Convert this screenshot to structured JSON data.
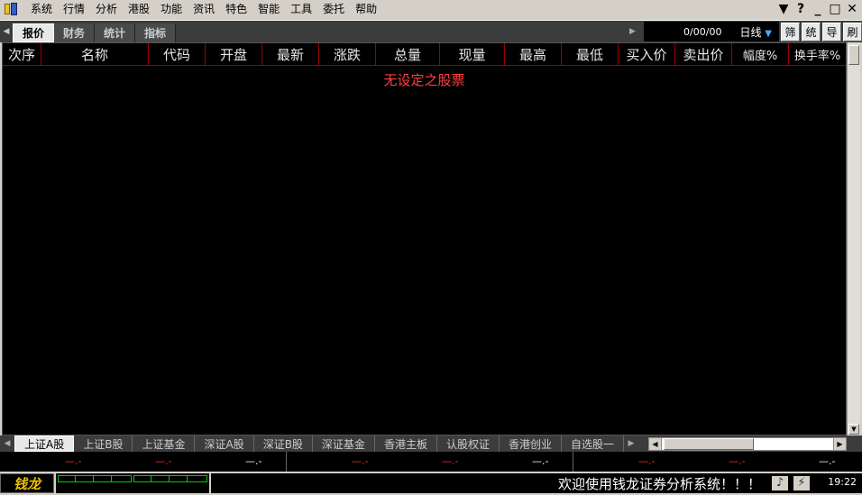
{
  "menu": [
    "系统",
    "行情",
    "分析",
    "港股",
    "功能",
    "资讯",
    "特色",
    "智能",
    "工具",
    "委托",
    "帮助"
  ],
  "window_controls": [
    "▼",
    "?",
    "_",
    "□",
    "✕"
  ],
  "toolbar": {
    "tabs": [
      "报价",
      "财务",
      "统计",
      "指标"
    ],
    "date": "0/00/00",
    "period": "日线",
    "buttons": [
      "筛",
      "统",
      "导",
      "刷"
    ]
  },
  "table": {
    "columns": [
      "次序",
      "名称",
      "代码",
      "开盘",
      "最新",
      "涨跌",
      "总量",
      "现量",
      "最高",
      "最低",
      "买入价",
      "卖出价",
      "幅度%",
      "换手率%"
    ],
    "empty_message": "无设定之股票"
  },
  "markets": [
    "上证A股",
    "上证B股",
    "上证基金",
    "深证A股",
    "深证B股",
    "深证基金",
    "香港主板",
    "认股权证",
    "香港创业",
    "自选股一"
  ],
  "indices": [
    {
      "values": [
        "—.-",
        "—.-",
        "—.-"
      ]
    },
    {
      "values": [
        "—.-",
        "—.-",
        "—.-"
      ]
    },
    {
      "values": [
        "—.-",
        "—.-",
        "—.-"
      ]
    }
  ],
  "status": {
    "logo": "钱龙",
    "welcome": "欢迎使用钱龙证券分析系统！！！",
    "time": "19:22"
  },
  "colors": {
    "accent_red": "#ff3030",
    "grid_line": "#a00000",
    "bg": "#000000"
  }
}
